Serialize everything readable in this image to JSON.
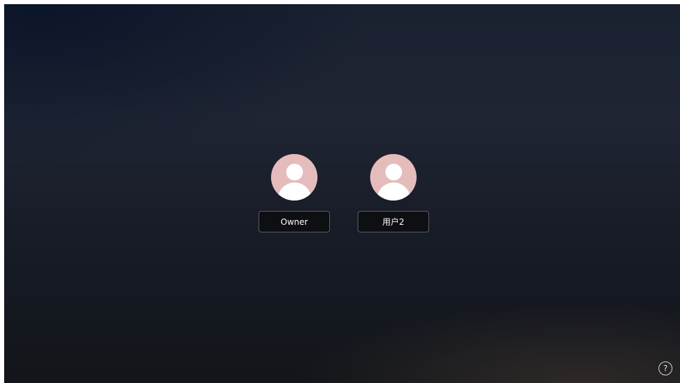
{
  "users": [
    {
      "name": "Owner",
      "avatar_icon": "default-user-icon"
    },
    {
      "name": "用户2",
      "avatar_icon": "default-user-icon"
    }
  ],
  "help": {
    "glyph": "?",
    "icon": "help-icon"
  },
  "colors": {
    "avatar_bg": "#e5bcbc",
    "button_bg": "#0d0f12",
    "button_border": "#5a5d63",
    "text": "#ffffff"
  }
}
